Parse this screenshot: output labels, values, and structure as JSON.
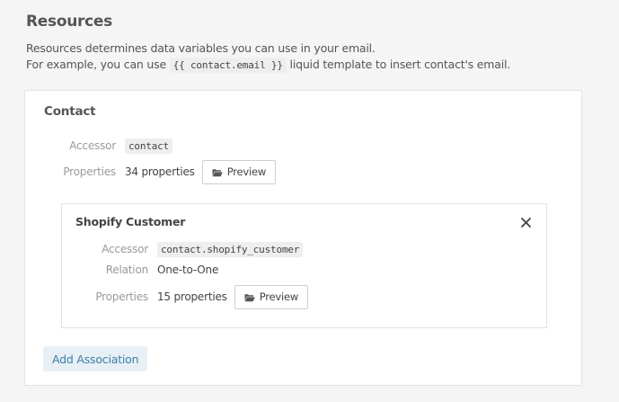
{
  "header": {
    "title": "Resources",
    "description_line1": "Resources determines data variables you can use in your email.",
    "description_prefix": "For example, you can use",
    "description_code": "{{ contact.email }}",
    "description_suffix": "liquid template to insert contact's email."
  },
  "contact": {
    "title": "Contact",
    "accessor_label": "Accessor",
    "accessor_value": "contact",
    "properties_label": "Properties",
    "properties_value": "34 properties",
    "preview_label": "Preview"
  },
  "association": {
    "title": "Shopify Customer",
    "accessor_label": "Accessor",
    "accessor_value": "contact.shopify_customer",
    "relation_label": "Relation",
    "relation_value": "One-to-One",
    "properties_label": "Properties",
    "properties_value": "15 properties",
    "preview_label": "Preview"
  },
  "actions": {
    "add_association_label": "Add Association"
  },
  "icons": {
    "preview": "folder-open-icon",
    "close": "close-icon"
  }
}
